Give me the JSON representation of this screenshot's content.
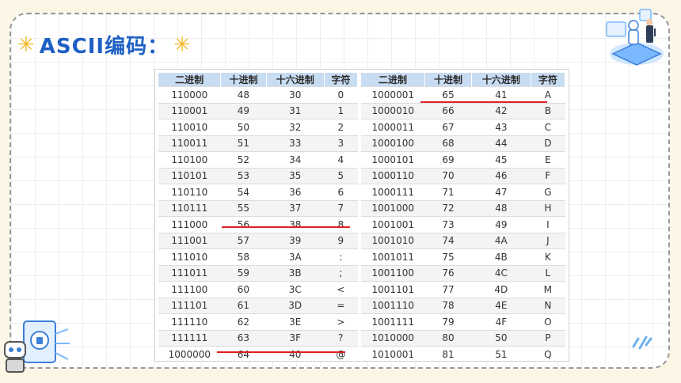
{
  "title": "ASCII编码：",
  "table_left": {
    "headers": [
      "二进制",
      "十进制",
      "十六进制",
      "字符"
    ],
    "rows": [
      [
        "110000",
        "48",
        "30",
        "0"
      ],
      [
        "110001",
        "49",
        "31",
        "1"
      ],
      [
        "110010",
        "50",
        "32",
        "2"
      ],
      [
        "110011",
        "51",
        "33",
        "3"
      ],
      [
        "110100",
        "52",
        "34",
        "4"
      ],
      [
        "110101",
        "53",
        "35",
        "5"
      ],
      [
        "110110",
        "54",
        "36",
        "6"
      ],
      [
        "110111",
        "55",
        "37",
        "7"
      ],
      [
        "111000",
        "56",
        "38",
        "8"
      ],
      [
        "111001",
        "57",
        "39",
        "9"
      ],
      [
        "111010",
        "58",
        "3A",
        ":"
      ],
      [
        "111011",
        "59",
        "3B",
        ";"
      ],
      [
        "111100",
        "60",
        "3C",
        "<"
      ],
      [
        "111101",
        "61",
        "3D",
        "="
      ],
      [
        "111110",
        "62",
        "3E",
        ">"
      ],
      [
        "111111",
        "63",
        "3F",
        "?"
      ],
      [
        "1000000",
        "64",
        "40",
        "@"
      ]
    ]
  },
  "table_right": {
    "headers": [
      "二进制",
      "十进制",
      "十六进制",
      "字符"
    ],
    "rows": [
      [
        "1000001",
        "65",
        "41",
        "A"
      ],
      [
        "1000010",
        "66",
        "42",
        "B"
      ],
      [
        "1000011",
        "67",
        "43",
        "C"
      ],
      [
        "1000100",
        "68",
        "44",
        "D"
      ],
      [
        "1000101",
        "69",
        "45",
        "E"
      ],
      [
        "1000110",
        "70",
        "46",
        "F"
      ],
      [
        "1000111",
        "71",
        "47",
        "G"
      ],
      [
        "1001000",
        "72",
        "48",
        "H"
      ],
      [
        "1001001",
        "73",
        "49",
        "I"
      ],
      [
        "1001010",
        "74",
        "4A",
        "J"
      ],
      [
        "1001011",
        "75",
        "4B",
        "K"
      ],
      [
        "1001100",
        "76",
        "4C",
        "L"
      ],
      [
        "1001101",
        "77",
        "4D",
        "M"
      ],
      [
        "1001110",
        "78",
        "4E",
        "N"
      ],
      [
        "1001111",
        "79",
        "4F",
        "O"
      ],
      [
        "1010000",
        "80",
        "50",
        "P"
      ],
      [
        "1010001",
        "81",
        "51",
        "Q"
      ]
    ]
  },
  "colors": {
    "title": "#1d5fc4",
    "star": "#f2b822",
    "header_bg": "#c8dcf2",
    "underline": "#e02020"
  },
  "icons": [
    "star-icon",
    "robot-illustration",
    "robot-corner-illustration"
  ]
}
